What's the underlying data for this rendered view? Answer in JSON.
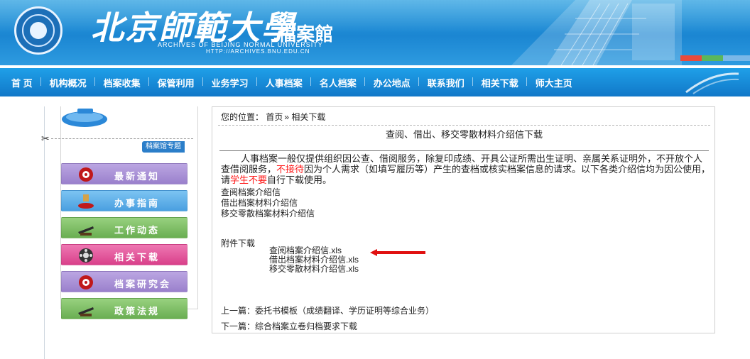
{
  "header": {
    "brand_cn": "北京師範大學",
    "brand_suffix": ".檔案館",
    "brand_en": "ARCHIVES OF BEIJING NORMAL UNIVERSITY",
    "brand_url": "HTTP://ARCHIVES.BNU.EDU.CN"
  },
  "nav": {
    "items": [
      {
        "label": "首 页"
      },
      {
        "label": "机构概况"
      },
      {
        "label": "档案收集"
      },
      {
        "label": "保管利用"
      },
      {
        "label": "业务学习"
      },
      {
        "label": "人事档案"
      },
      {
        "label": "名人档案"
      },
      {
        "label": "办公地点"
      },
      {
        "label": "联系我们"
      },
      {
        "label": "相关下载"
      },
      {
        "label": "师大主页"
      }
    ]
  },
  "sidebar": {
    "topic_tag": "档案馆专题",
    "items": [
      {
        "label": "最新通知",
        "color": "#a98fd6"
      },
      {
        "label": "办事指南",
        "color": "#5fb0e8"
      },
      {
        "label": "工作动态",
        "color": "#7fbf67"
      },
      {
        "label": "相关下载",
        "color": "#e2559b"
      },
      {
        "label": "档案研究会",
        "color": "#a98fd6"
      },
      {
        "label": "政策法规",
        "color": "#7fbf67"
      }
    ]
  },
  "breadcrumb": {
    "prefix": "您的位置：",
    "home": "首页",
    "sep": "»",
    "current": "相关下载"
  },
  "article": {
    "title": "查阅、借出、移交零散材料介绍信下载",
    "para_a": "人事档案一般仅提供组织因公查、借阅服务，除复印成绩、开具公证所需出生证明、亲属关系证明外，不开放个人查借阅服务，",
    "para_red1": "不接待",
    "para_b": "因为个人需求（如填写履历等）产生的查档或核实档案信息的请求。以下各类介绍信均为因公使用，请",
    "para_red2": "学生不要",
    "para_c": "自行下载使用。",
    "links": [
      "查阅档案介绍信",
      "借出档案材料介绍信",
      "移交零散档案材料介绍信"
    ],
    "attachments_heading": "附件下载",
    "files": [
      "查阅档案介绍信.xls",
      "借出档案材料介绍信.xls",
      "移交零散材料介绍信.xls"
    ],
    "prev": "上一篇：委托书模板（成绩翻译、学历证明等综合业务）",
    "next": "下一篇：综合档案立卷归档要求下载"
  },
  "colors": {
    "header_blue": "#1b86d2",
    "annotation_arrow": "#e01010",
    "highlight_red": "#ff1a1a"
  }
}
